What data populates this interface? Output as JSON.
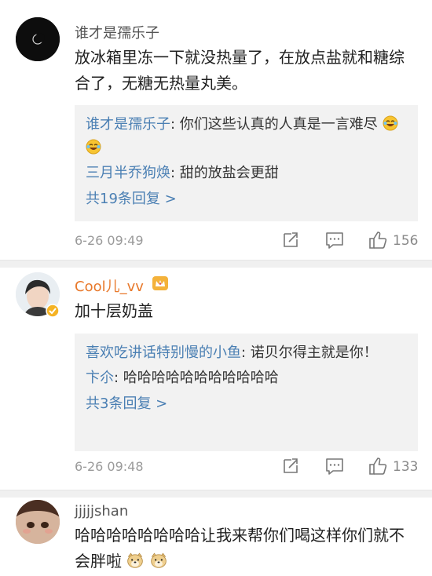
{
  "comments": [
    {
      "username": "谁才是孺乐子",
      "text": "放冰箱里冻一下就没热量了，在放点盐就和糖综合了，无糖无热量丸美。",
      "replies": [
        {
          "user": "谁才是孺乐子",
          "text": "你们这些认真的人真是一言难尽"
        },
        {
          "user": "三月半乔狗焕",
          "text": "甜的放盐会更甜"
        }
      ],
      "more_replies": "共19条回复 >",
      "timestamp": "6-26 09:49",
      "likes": "156"
    },
    {
      "username": "Cool儿_vv",
      "text": "加十层奶盖",
      "replies": [
        {
          "user": "喜欢吃讲话特别慢的小鱼",
          "text": "诺贝尔得主就是你！"
        },
        {
          "user": "卞尒",
          "text": "哈哈哈哈哈哈哈哈哈哈哈"
        }
      ],
      "more_replies": "共3条回复 >",
      "timestamp": "6-26 09:48",
      "likes": "133"
    },
    {
      "username": "jjjjjshan",
      "text": "哈哈哈哈哈哈哈哈让我来帮你们喝这样你们就不会胖啦"
    }
  ],
  "colors": {
    "link_blue": "#4a7fb3",
    "username_gray": "#555555",
    "meta_gray": "#9a9a9a",
    "vip_orange": "#e8782a",
    "reply_bg": "#f2f2f2"
  },
  "icons": [
    "repost-icon",
    "comment-icon",
    "like-icon",
    "laugh-cry-emoji",
    "doge-emoji",
    "verified-badge-icon",
    "crown-badge-icon"
  ]
}
